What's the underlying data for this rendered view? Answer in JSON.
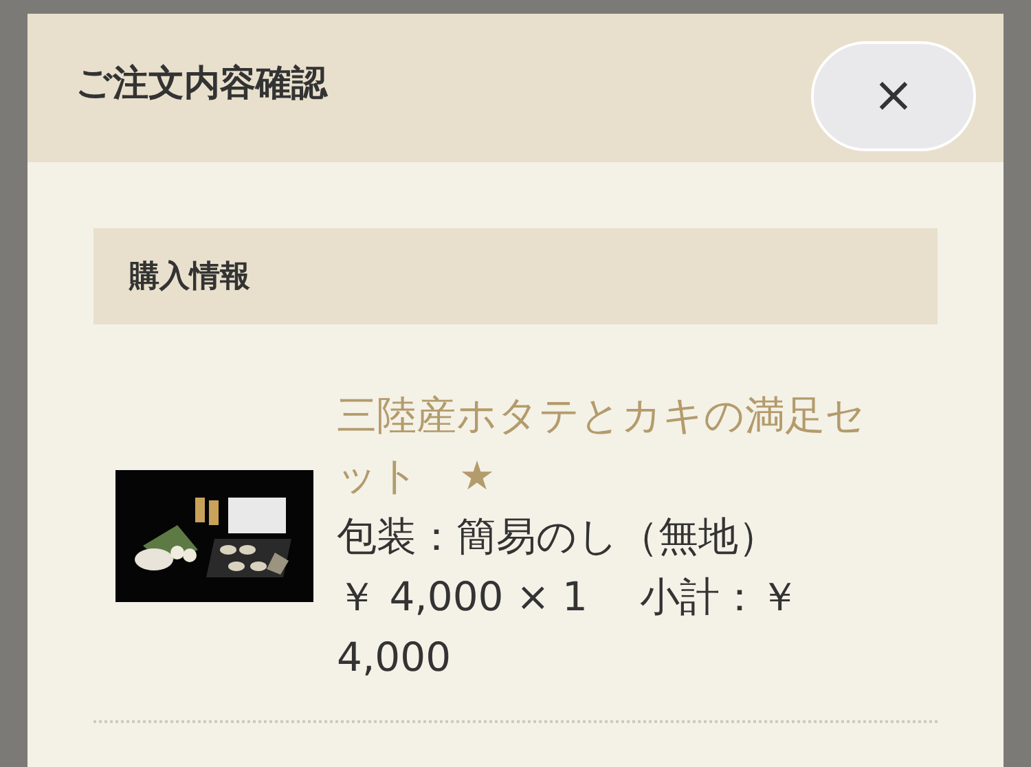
{
  "modal": {
    "title": "ご注文内容確認",
    "close_label": "×",
    "section": {
      "title": "購入情報",
      "items": [
        {
          "kind": "picture",
          "name": "三陸産ホタテとカキの満足セット　★",
          "wrapping": "包装：簡易のし（無地）",
          "price_line": "￥ 4,000 × 1　 小計：￥ 4,000"
        }
      ]
    }
  }
}
